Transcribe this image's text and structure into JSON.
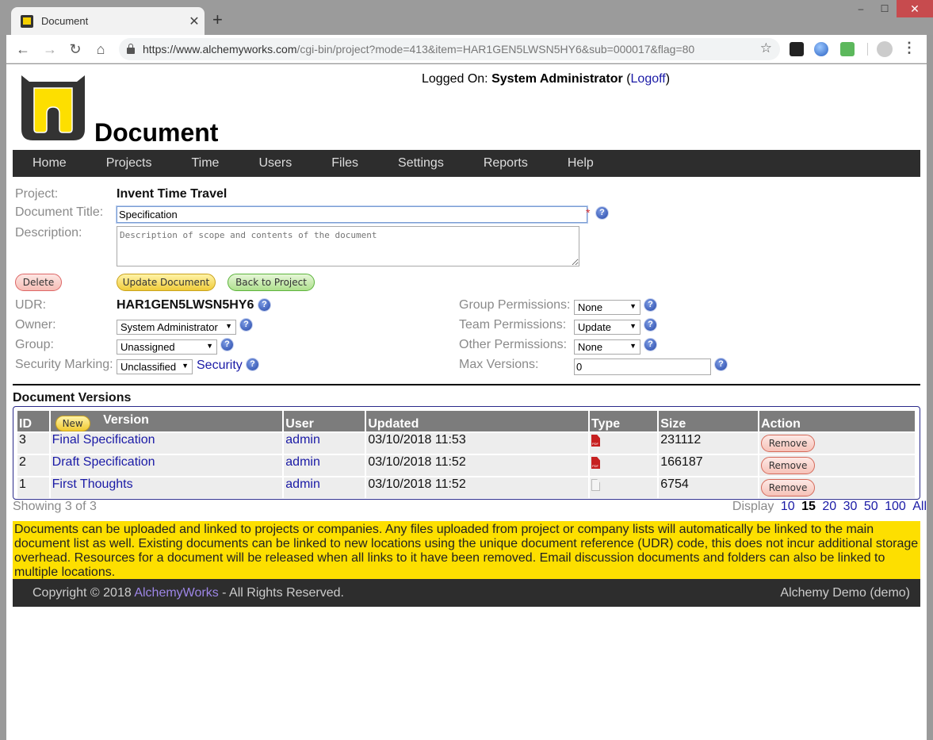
{
  "browser": {
    "tab_title": "Document",
    "url_host": "https://www.alchemyworks.com",
    "url_path": "/cgi-bin/project?mode=413&item=HAR1GEN5LWSN5HY6&sub=000017&flag=80",
    "icons": {
      "back": "←",
      "forward": "→",
      "reload": "↻",
      "home": "⌂",
      "star": "☆",
      "menu": "⋮",
      "close": "✕",
      "new_tab": "+",
      "minimize": "–",
      "maximize": "☐"
    }
  },
  "header": {
    "page_title": "Document",
    "logged_on_label": "Logged On:",
    "user_name": "System Administrator",
    "logoff_open": "(",
    "logoff_label": "Logoff",
    "logoff_close": ")"
  },
  "nav": {
    "items": [
      "Home",
      "Projects",
      "Time",
      "Users",
      "Files",
      "Settings",
      "Reports",
      "Help"
    ]
  },
  "form": {
    "project_label": "Project:",
    "project_value": "Invent Time Travel",
    "title_label": "Document Title:",
    "title_value": "Specification",
    "required_mark": "*",
    "description_label": "Description:",
    "description_placeholder": "Description of scope and contents of the document",
    "delete_label": "Delete",
    "update_label": "Update Document",
    "back_label": "Back to Project",
    "udr_label": "UDR:",
    "udr_value": "HAR1GEN5LWSN5HY6",
    "owner_label": "Owner:",
    "owner_value": "System Administrator",
    "group_label": "Group:",
    "group_value": "Unassigned",
    "security_label": "Security Marking:",
    "security_value": "Unclassified",
    "security_link": "Security",
    "group_perm_label": "Group Permissions:",
    "group_perm_value": "None",
    "team_perm_label": "Team Permissions:",
    "team_perm_value": "Update",
    "other_perm_label": "Other Permissions:",
    "other_perm_value": "None",
    "max_versions_label": "Max Versions:",
    "max_versions_value": "0",
    "help_glyph": "?",
    "dropdown_arrow": "▼"
  },
  "versions": {
    "title": "Document Versions",
    "new_label": "New",
    "columns": [
      "ID",
      "Version",
      "User",
      "Updated",
      "Type",
      "Size",
      "Action"
    ],
    "rows": [
      {
        "id": "3",
        "version": "Final Specification",
        "user": "admin",
        "updated": "03/10/2018 11:53",
        "type": "pdf",
        "size": "231112",
        "action": "Remove"
      },
      {
        "id": "2",
        "version": "Draft Specification",
        "user": "admin",
        "updated": "03/10/2018 11:52",
        "type": "pdf",
        "size": "166187",
        "action": "Remove"
      },
      {
        "id": "1",
        "version": "First Thoughts",
        "user": "admin",
        "updated": "03/10/2018 11:52",
        "type": "txt",
        "size": "6754",
        "action": "Remove"
      }
    ],
    "showing": "Showing 3 of 3",
    "display_label": "Display",
    "page_sizes": [
      "10",
      "15",
      "20",
      "30",
      "50",
      "100",
      "All"
    ],
    "current_page_size": "15"
  },
  "info_text": "Documents can be uploaded and linked to projects or companies. Any files uploaded from project or company lists will automatically be linked to the main document list as well. Existing documents can be linked to new locations using the unique document reference (UDR) code, this does not incur additional storage overhead. Resources for a document will be released when all links to it have been removed. Email discussion documents and folders can also be linked to multiple locations.",
  "footer": {
    "copyright_prefix": "Copyright © 2018 ",
    "brand": "AlchemyWorks",
    "copyright_suffix": " - All Rights Reserved.",
    "instance": "Alchemy Demo (demo)"
  },
  "colors": {
    "nav_bg": "#2d2d2d",
    "info_bg": "#fddf00",
    "link": "#1a1aa6",
    "table_header": "#7c7c7c",
    "brand_link": "#9d86e6"
  }
}
